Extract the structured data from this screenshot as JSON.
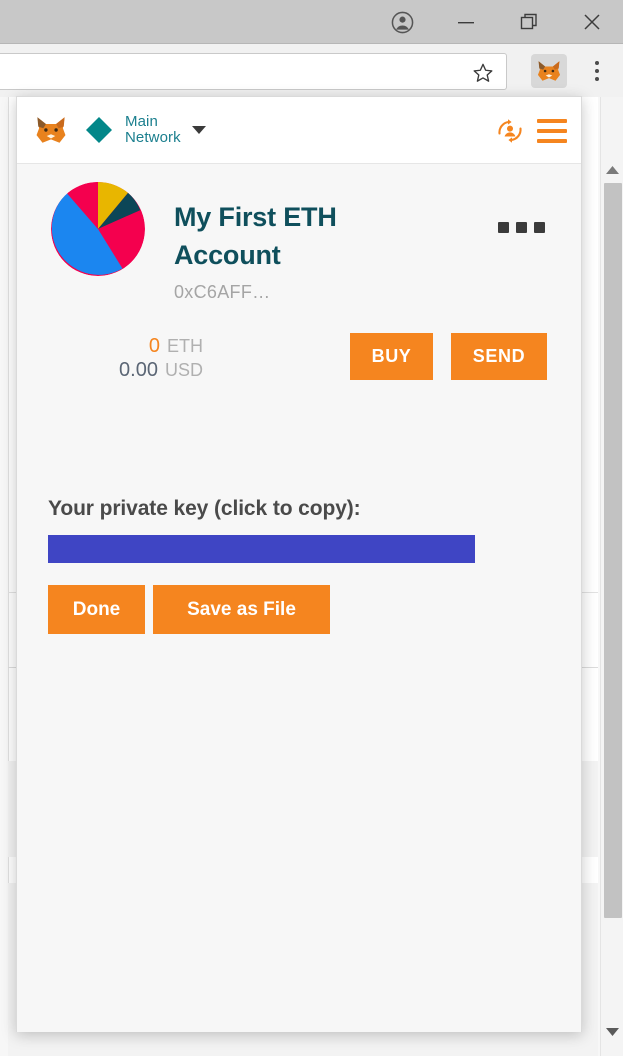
{
  "window": {
    "controls": [
      {
        "name": "profile-avatar",
        "icon": "account-circle-icon",
        "label": "Profile"
      },
      {
        "name": "minimize",
        "icon": "minimize-icon",
        "label": "Minimize"
      },
      {
        "name": "restore",
        "icon": "restore-icon",
        "label": "Restore"
      },
      {
        "name": "close",
        "icon": "close-icon",
        "label": "Close"
      }
    ]
  },
  "browser": {
    "omnibox": {
      "value": "",
      "placeholder": ""
    },
    "bookmark_icon": "star-icon",
    "extension_icon": "metamask-fox-icon",
    "menu_icon": "chrome-menu-icon"
  },
  "popup": {
    "header": {
      "logo_icon": "metamask-fox-icon",
      "network_icon": "ethereum-diamond-icon",
      "network_label": "Main\nNetwork",
      "network_label_line1": "Main",
      "network_label_line2": "Network",
      "dropdown_icon": "caret-down-icon",
      "account_switch_icon": "account-switch-icon",
      "menu_icon": "hamburger-menu-icon"
    },
    "account": {
      "identicon": "pie-identicon",
      "name": "My First ETH Account",
      "address": "0xC6AFF…",
      "options_icon": "ellipsis-icon"
    },
    "balance": {
      "eth_amount": "0",
      "eth_unit": "ETH",
      "usd_amount": "0.00",
      "usd_unit": "USD"
    },
    "actions": {
      "buy_label": "BUY",
      "send_label": "SEND"
    },
    "private_key": {
      "label": "Your private key (click to copy):",
      "value": "",
      "done_label": "Done",
      "save_label": "Save as File"
    }
  },
  "scrollbar": {
    "up_icon": "scroll-up-arrow-icon",
    "down_icon": "scroll-down-arrow-icon"
  },
  "colors": {
    "accent_orange": "#f5851f",
    "teal": "#1b7f8e",
    "account_name": "#0f4f5c",
    "private_key_bar": "#3f45c4",
    "popup_bg": "#f7f7f7"
  },
  "identicon_slices": [
    {
      "color": "#e8b600",
      "label": "gold"
    },
    {
      "color": "#0c4657",
      "label": "dark-teal"
    },
    {
      "color": "#f4004e",
      "label": "crimson"
    },
    {
      "color": "#1b86f0",
      "label": "blue"
    }
  ]
}
